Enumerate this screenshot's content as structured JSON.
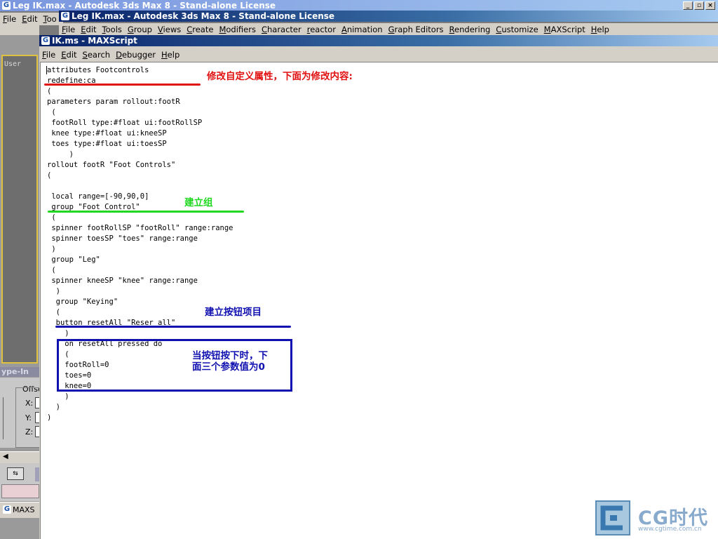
{
  "windows": {
    "back_title": "Leg IK.max - Autodesk 3ds Max 8  - Stand-alone License",
    "front_title": "Leg IK.max - Autodesk 3ds Max 8  - Stand-alone License",
    "back_menu": [
      "File",
      "Edit",
      "Too"
    ],
    "max_menu": [
      "File",
      "Edit",
      "Tools",
      "Group",
      "Views",
      "Create",
      "Modifiers",
      "Character",
      "reactor",
      "Animation",
      "Graph Editors",
      "Rendering",
      "Customize",
      "MAXScript",
      "Help"
    ]
  },
  "left_panel": {
    "viewport_label": "User",
    "typein_title": "ype-In",
    "offset_label": "Offse",
    "axes": [
      "X:",
      "Y:",
      "Z:"
    ],
    "maxs_label": "MAXS"
  },
  "editor": {
    "title": "IK.ms - MAXScript",
    "menu": [
      "File",
      "Edit",
      "Search",
      "Debugger",
      "Help"
    ],
    "code_lines": [
      "attributes Footcontrols",
      "redefine:ca",
      "(",
      "parameters param rollout:footR",
      " (",
      " footRoll type:#float ui:footRollSP",
      " knee type:#float ui:kneeSP",
      " toes type:#float ui:toesSP",
      "     )",
      "rollout footR \"Foot Controls\"",
      "(",
      "",
      " local range=[-90,90,0]",
      " group \"Foot Control\"",
      " (",
      " spinner footRollSP \"footRoll\" range:range",
      " spinner toesSP \"toes\" range:range",
      " )",
      " group \"Leg\"",
      " (",
      " spinner kneeSP \"knee\" range:range",
      "  )",
      "  group \"Keying\"",
      "  (",
      "  button resetAll \"Reser all\"",
      "    )",
      "    on resetAll pressed do",
      "    (",
      "    footRoll=0",
      "    toes=0",
      "    knee=0",
      "    )",
      "  )",
      ")"
    ]
  },
  "annotations": {
    "redefine_note": "修改自定义属性，下面为修改内容:",
    "group_note": "建立组",
    "button_note": "建立按钮项目",
    "reset_note_line1": "当按钮按下时，下",
    "reset_note_line2": "面三个参数值为0"
  },
  "colors": {
    "red": "#e01010",
    "green": "#20d820",
    "blue": "#1010b0"
  },
  "watermark": {
    "brand": "CG时代",
    "url": "www.cgtime.com.cn"
  }
}
